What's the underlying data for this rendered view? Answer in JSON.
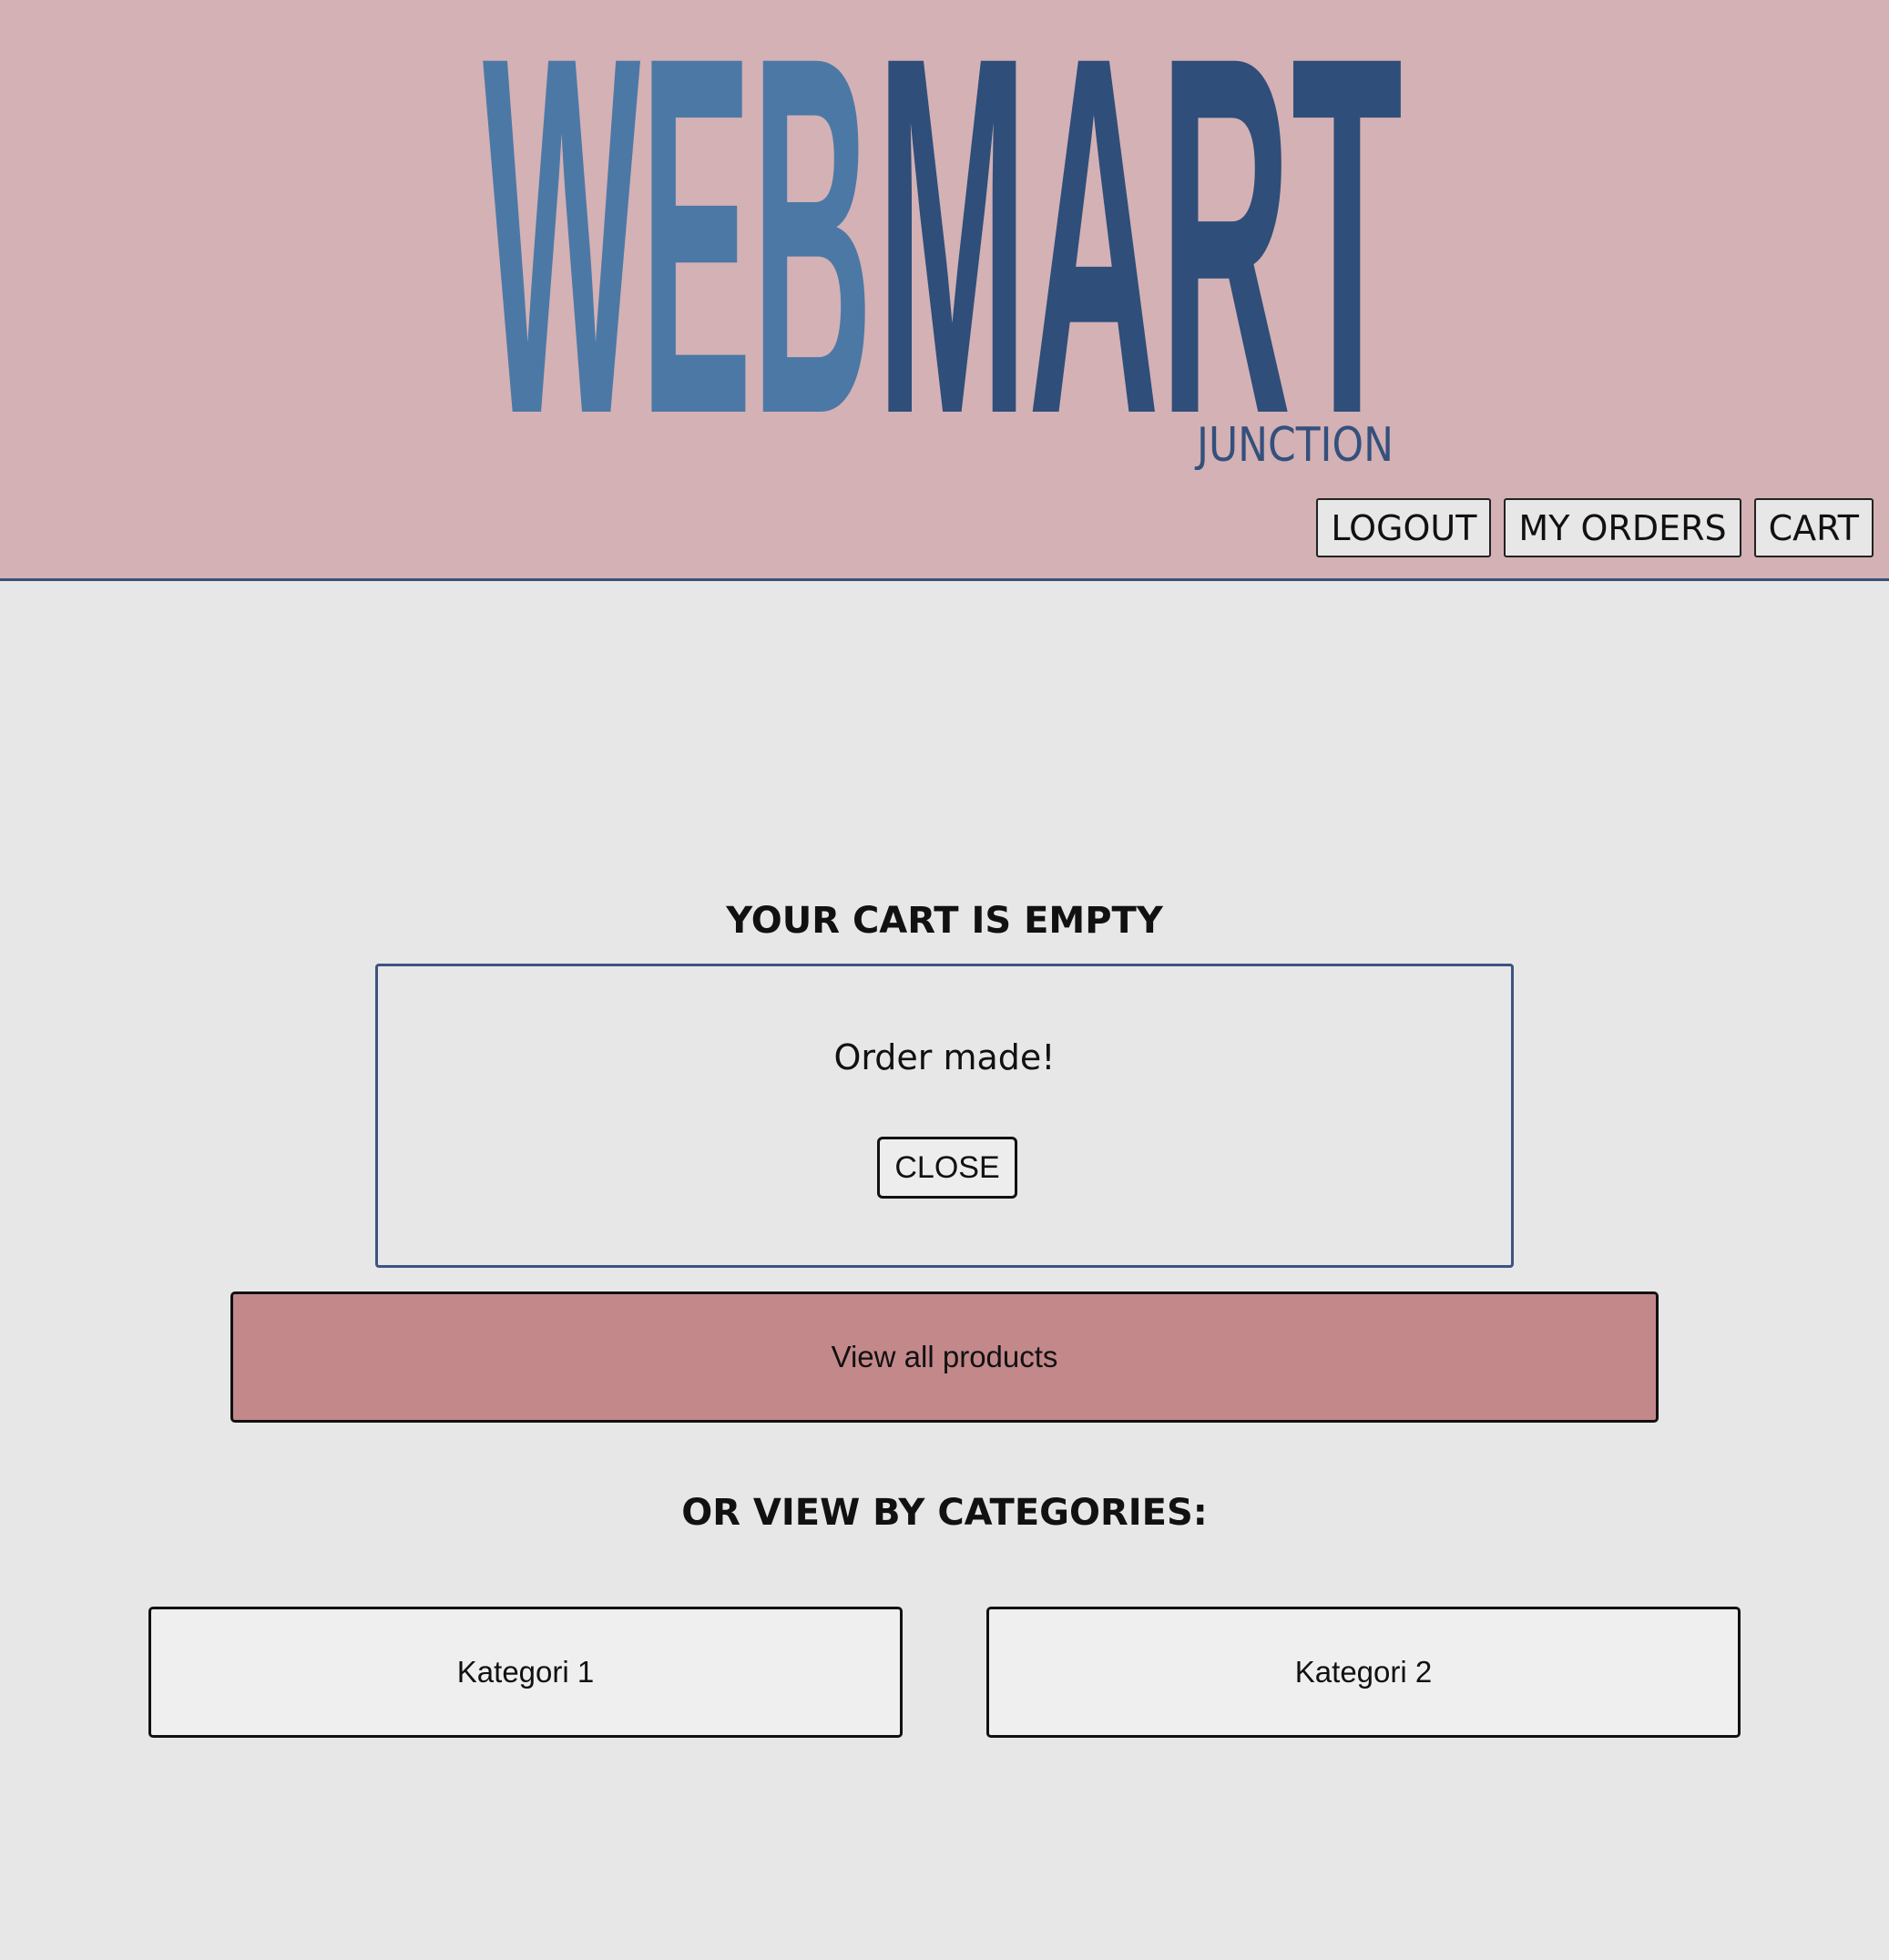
{
  "header": {
    "logo": {
      "word_1": "WEB",
      "word_2": "MART",
      "tagline": "JUNCTION",
      "color_web": "#4c78a6",
      "color_mart": "#2f4e7a",
      "color_tagline": "#34507d"
    },
    "nav": {
      "logout": "LOGOUT",
      "my_orders": "MY ORDERS",
      "cart": "CART"
    },
    "background": "#d3b1b4"
  },
  "main": {
    "cart_status": "YOUR CART IS EMPTY",
    "modal": {
      "message": "Order made!",
      "close_label": "CLOSE"
    },
    "view_all_label": "View all products",
    "categories_heading": "OR VIEW BY CATEGORIES:",
    "categories": [
      {
        "label": "Kategori 1"
      },
      {
        "label": "Kategori 2"
      }
    ],
    "accent_color": "#c3888a"
  }
}
